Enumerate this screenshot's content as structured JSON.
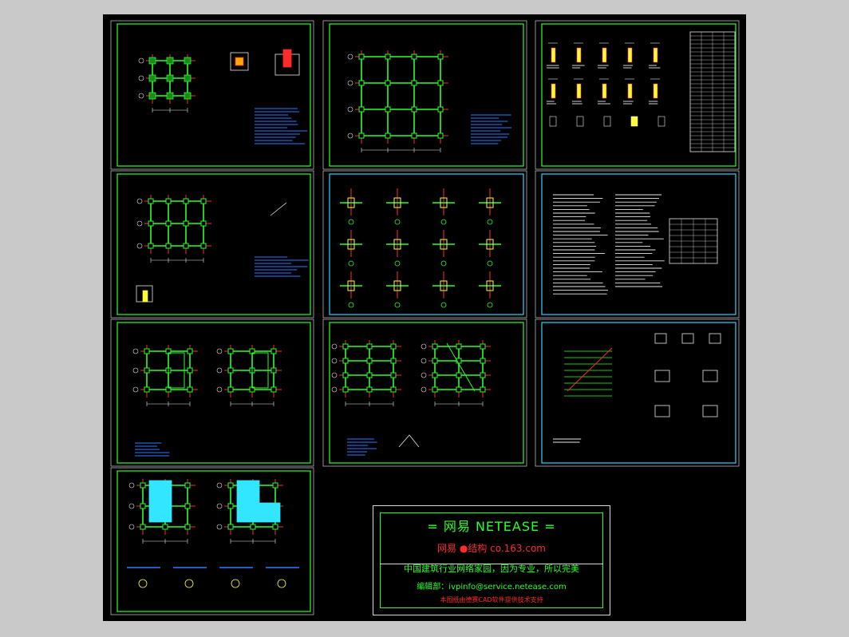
{
  "title_block": {
    "brand": "= 网易   NETEASE =",
    "sub": "网易 ●结构   co.163.com",
    "slogan": "中国建筑行业网络家园，因为专业，所以完美",
    "email": "编辑部：ivpinfo@service.netease.com",
    "note": "本图纸由德赛CAD软件提供技术支持"
  },
  "colors": {
    "frame": "#2aff2a",
    "cyan_frame": "#2ad4ff",
    "grid_red": "#ff2a2a",
    "member_green": "#2aff2a",
    "fill_yellow": "#ffff33",
    "fill_cyan": "#33e6ff",
    "text_white": "#e8e8e8",
    "annotation_blue": "#2a7dff"
  },
  "sheets": [
    {
      "id": "foundation-plan",
      "row": 1,
      "col": 1,
      "frame": "green"
    },
    {
      "id": "beam-grid-plan",
      "row": 1,
      "col": 2,
      "frame": "green"
    },
    {
      "id": "column-schedule",
      "row": 1,
      "col": 3,
      "frame": "green"
    },
    {
      "id": "column-layout-plan",
      "row": 2,
      "col": 1,
      "frame": "green"
    },
    {
      "id": "node-details",
      "row": 2,
      "col": 2,
      "frame": "cyan"
    },
    {
      "id": "design-notes",
      "row": 2,
      "col": 3,
      "frame": "cyan"
    },
    {
      "id": "floor-plans-a",
      "row": 3,
      "col": 1,
      "frame": "green"
    },
    {
      "id": "floor-plans-b",
      "row": 3,
      "col": 2,
      "frame": "green"
    },
    {
      "id": "stair-details",
      "row": 3,
      "col": 3,
      "frame": "cyan"
    },
    {
      "id": "roof-plans",
      "row": 4,
      "col": 1,
      "frame": "green"
    }
  ]
}
